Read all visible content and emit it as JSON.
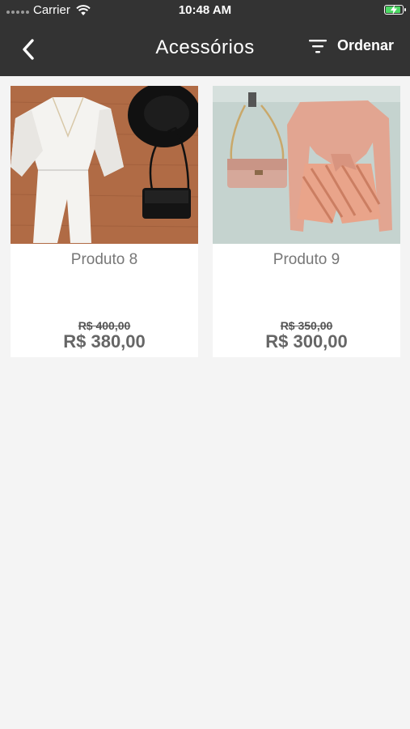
{
  "status_bar": {
    "carrier": "Carrier",
    "time": "10:48 AM",
    "battery_color": "#4cd964",
    "icons": [
      "signal-dots-icon",
      "wifi-icon",
      "battery-charging-icon"
    ]
  },
  "nav": {
    "back_icon": "chevron-left-icon",
    "title": "Acessórios",
    "sort_icon": "filter-lines-icon",
    "sort_label": "Ordenar"
  },
  "colors": {
    "header_bg": "#333333",
    "page_bg": "#f4f4f4",
    "card_bg": "#ffffff"
  },
  "products": [
    {
      "name": "Produto 8",
      "old_price": "R$ 400,00",
      "price": "R$ 380,00"
    },
    {
      "name": "Produto 9",
      "old_price": "R$ 350,00",
      "price": "R$ 300,00"
    }
  ]
}
